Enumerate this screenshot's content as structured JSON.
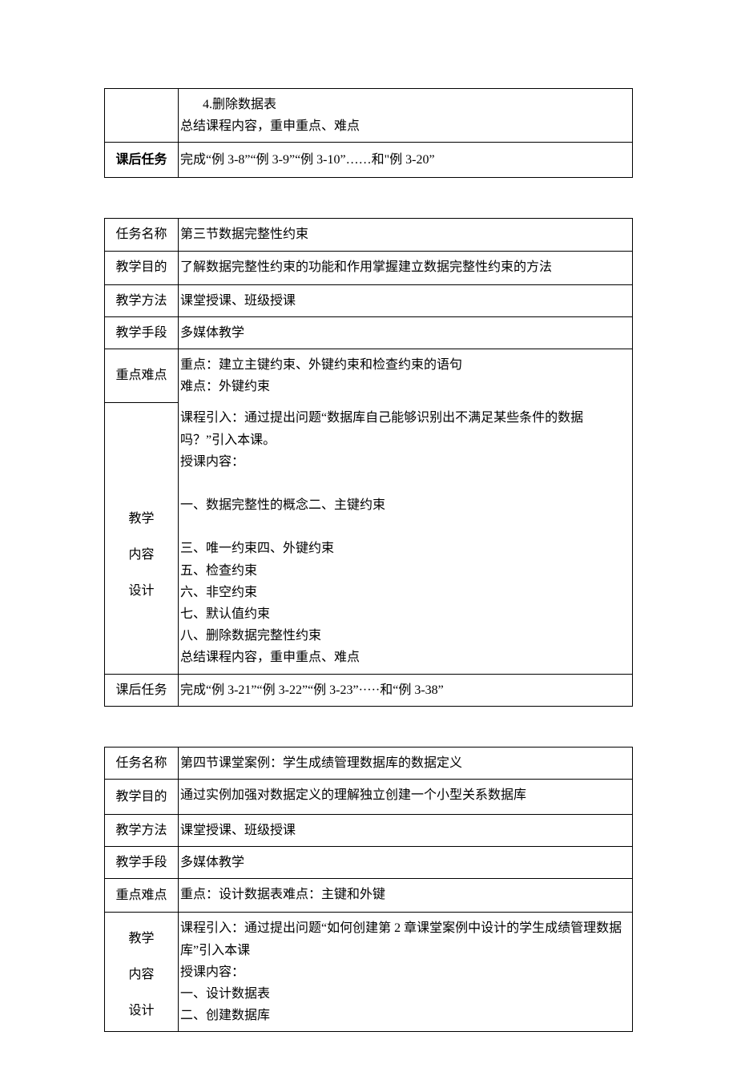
{
  "table1": {
    "content_lines": [
      "4.删除数据表",
      "总结课程内容，重申重点、难点"
    ],
    "homework_label": "课后任务",
    "homework": "完成“例 3-8”“例 3-9”“例 3-10”……和\"例 3-20”"
  },
  "table2": {
    "rows": {
      "task_name": {
        "label": "任务名称",
        "value": "第三节数据完整性约束"
      },
      "objective": {
        "label": "教学目的",
        "value": "了解数据完整性约束的功能和作用掌握建立数据完整性约束的方法"
      },
      "method": {
        "label": "教学方法",
        "value": "课堂授课、班级授课"
      },
      "means": {
        "label": "教学手段",
        "value": "多媒体教学"
      }
    },
    "keypoints": {
      "label": "重点难点",
      "line1": "重点：建立主键约束、外键约束和检查约束的语句",
      "line2": "难点：外键约束"
    },
    "design": {
      "label1": "教学",
      "label2": "内容",
      "label3": "设计",
      "intro1": "课程引入：通过提出问题“数据库自己能够识别出不满足某些条件的数据",
      "intro2": "吗？”引入本课。",
      "intro3": "授课内容：",
      "line1": "一、数据完整性的概念二、主键约束",
      "line2": "三、唯一约束四、外键约束",
      "line3": "五、检查约束",
      "line4": "六、非空约束",
      "line5": "七、默认值约束",
      "line6": "八、删除数据完整性约束",
      "line7": "总结课程内容，重申重点、难点"
    },
    "homework": {
      "label": "课后任务",
      "value": "完成“例 3-21”“例 3-22”“例 3-23”·····和“例 3-38”"
    }
  },
  "table3": {
    "rows": {
      "task_name": {
        "label": "任务名称",
        "value": "第四节课堂案例：学生成绩管理数据库的数据定义"
      },
      "objective": {
        "label": "教学目的",
        "value": "通过实例加强对数据定义的理解独立创建一个小型关系数据库"
      },
      "method": {
        "label": "教学方法",
        "value": "课堂授课、班级授课"
      },
      "means": {
        "label": "教学手段",
        "value": "多媒体教学"
      },
      "keypoints": {
        "label": "重点难点",
        "value": "重点：设计数据表难点：主键和外键"
      }
    },
    "design": {
      "label1": "教学",
      "label2": "内容",
      "label3": "设计",
      "intro1": "课程引入：通过提出问题“如何创建第 2 章课堂案例中设计的学生成绩管理数据",
      "intro2": "库”引入本课",
      "intro3": "授课内容：",
      "line1": "一、设计数据表",
      "line2": "二、创建数据库"
    }
  }
}
